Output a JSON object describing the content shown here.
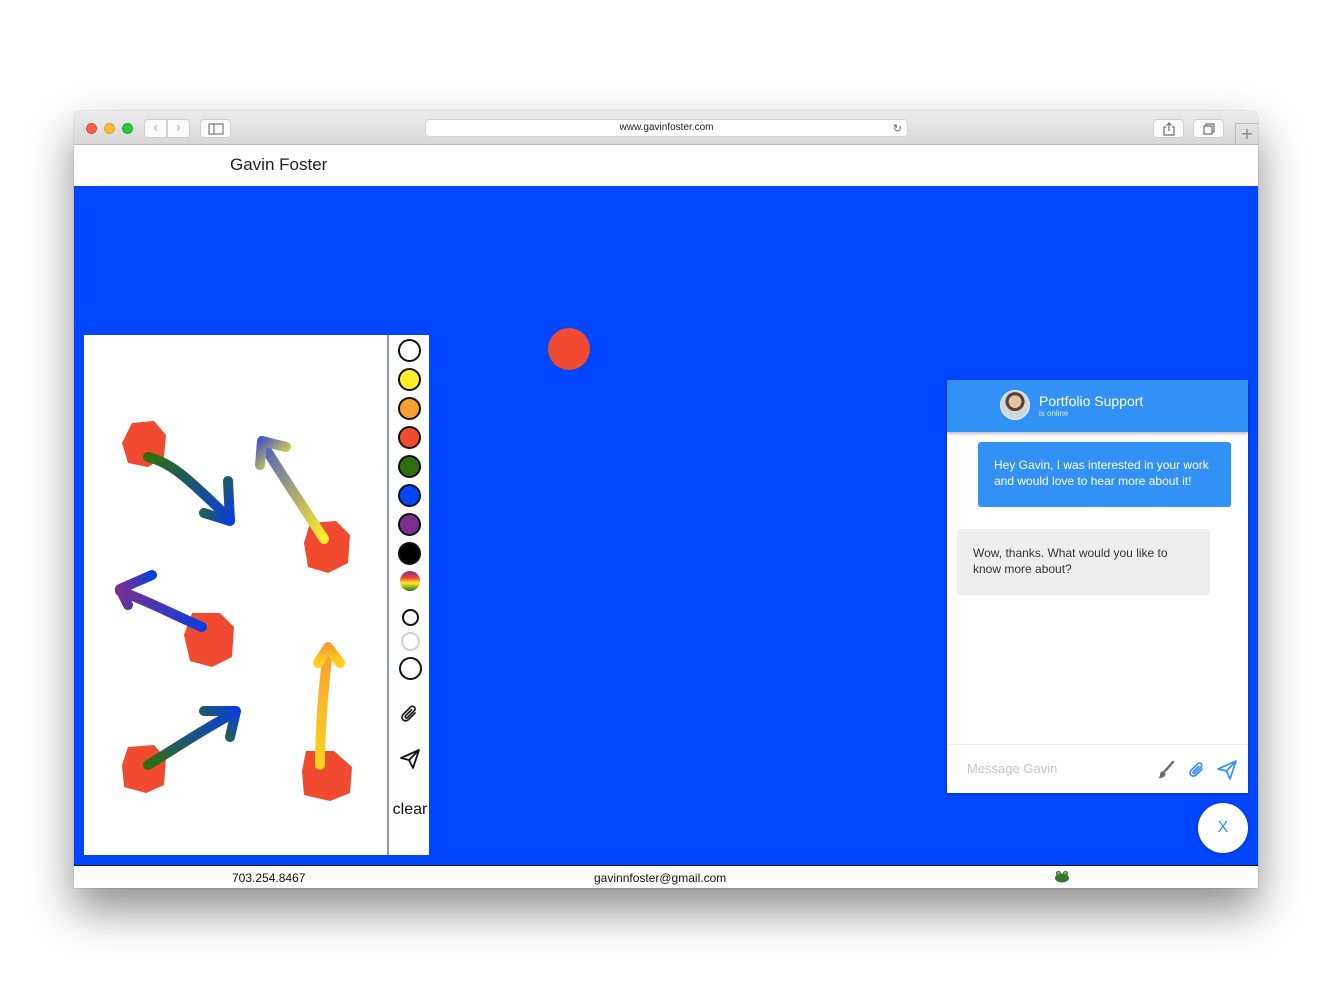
{
  "browser": {
    "url": "www.gavinfoster.com",
    "back_icon": "chevron-left-icon",
    "forward_icon": "chevron-right-icon",
    "reload_icon": "reload-icon",
    "back_glyph": "‹",
    "forward_glyph": "›",
    "reload_glyph": "↻",
    "new_tab_glyph": "+"
  },
  "header": {
    "site_name": "Gavin Foster"
  },
  "stage": {
    "background": "#0046ff",
    "dot_color": "#f04a31"
  },
  "drawing_tool": {
    "colors": [
      "#ffffff",
      "#ffee2e",
      "#f7a030",
      "#f04a31",
      "#2d6e0e",
      "#0046ff",
      "#7a2f8c",
      "#000000",
      "rainbow"
    ],
    "brush_sizes": [
      "small",
      "medium",
      "large"
    ],
    "attach_icon": "paperclip-icon",
    "send_icon": "paper-plane-icon",
    "clear_label": "clear"
  },
  "chat": {
    "title": "Portfolio Support",
    "status": "is online",
    "messages": [
      {
        "from": "visitor",
        "text": "Hey Gavin, I was interested in your work and would love to hear more about it!"
      },
      {
        "from": "agent",
        "text": "Wow, thanks. What would you like to know more about?"
      }
    ],
    "input_placeholder": "Message Gavin",
    "accent": "#3191f5",
    "close_label": "X"
  },
  "footer": {
    "phone": "703.254.8467",
    "email": "gavinnfoster@gmail.com",
    "logo_icon": "frog-icon"
  }
}
